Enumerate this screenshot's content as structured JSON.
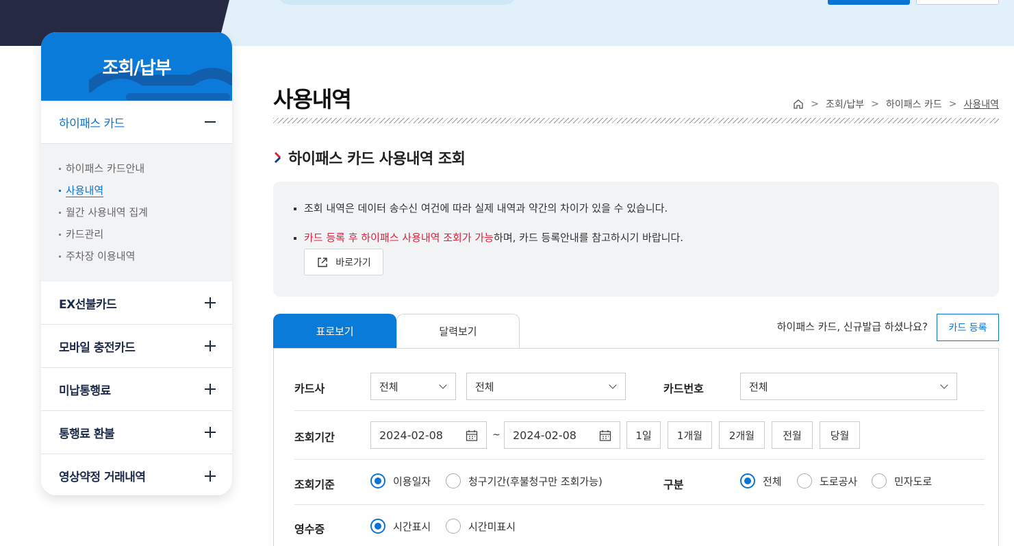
{
  "sidebar": {
    "title": "조회/납부",
    "active_menu": "하이패스 카드",
    "submenu": [
      "하이패스 카드안내",
      "사용내역",
      "월간 사용내역 집계",
      "카드관리",
      "주차장 이용내역"
    ],
    "menus": [
      "EX선불카드",
      "모바일 충전카드",
      "미납통행료",
      "통행료 환불",
      "영상약정 거래내역"
    ]
  },
  "page": {
    "title": "사용내역",
    "breadcrumb": [
      "조회/납부",
      "하이패스 카드",
      "사용내역"
    ],
    "section_title": "하이패스 카드 사용내역 조회"
  },
  "notice": {
    "line1": "조회 내역은 데이터 송수신 여건에 따라 실제 내역과 약간의 차이가 있을 수 있습니다.",
    "line2_red": "카드 등록 후 하이패스 사용내역 조회가 가능",
    "line2_rest": "하며, 카드 등록안내를 참고하시기 바랍니다.",
    "goto_label": "바로가기"
  },
  "tabs": {
    "table": "표로보기",
    "calendar": "달력보기"
  },
  "register": {
    "question": "하이패스 카드, 신규발급 하셨나요?",
    "button": "카드 등록"
  },
  "form": {
    "card_company_label": "카드사",
    "card_company_value": "전체",
    "card_company_sub_value": "전체",
    "card_number_label": "카드번호",
    "card_number_value": "전체",
    "period_label": "조회기간",
    "start_date": "2024-02-08",
    "end_date": "2024-02-08",
    "tilde": "~",
    "quick_periods": [
      "1일",
      "1개월",
      "2개월",
      "전월",
      "당월"
    ],
    "basis_label": "조회기준",
    "basis_options": [
      "이용일자",
      "청구기간(후불청구만 조회가능)"
    ],
    "type_label": "구분",
    "type_options": [
      "전체",
      "도로공사",
      "민자도로"
    ],
    "receipt_label": "영수증",
    "receipt_options": [
      "시간표시",
      "시간미표시"
    ]
  },
  "colors": {
    "primary": "#0a73d6",
    "header_blue": "#0a7bd9",
    "accent_red": "#e0203a",
    "dark": "#262b43"
  }
}
